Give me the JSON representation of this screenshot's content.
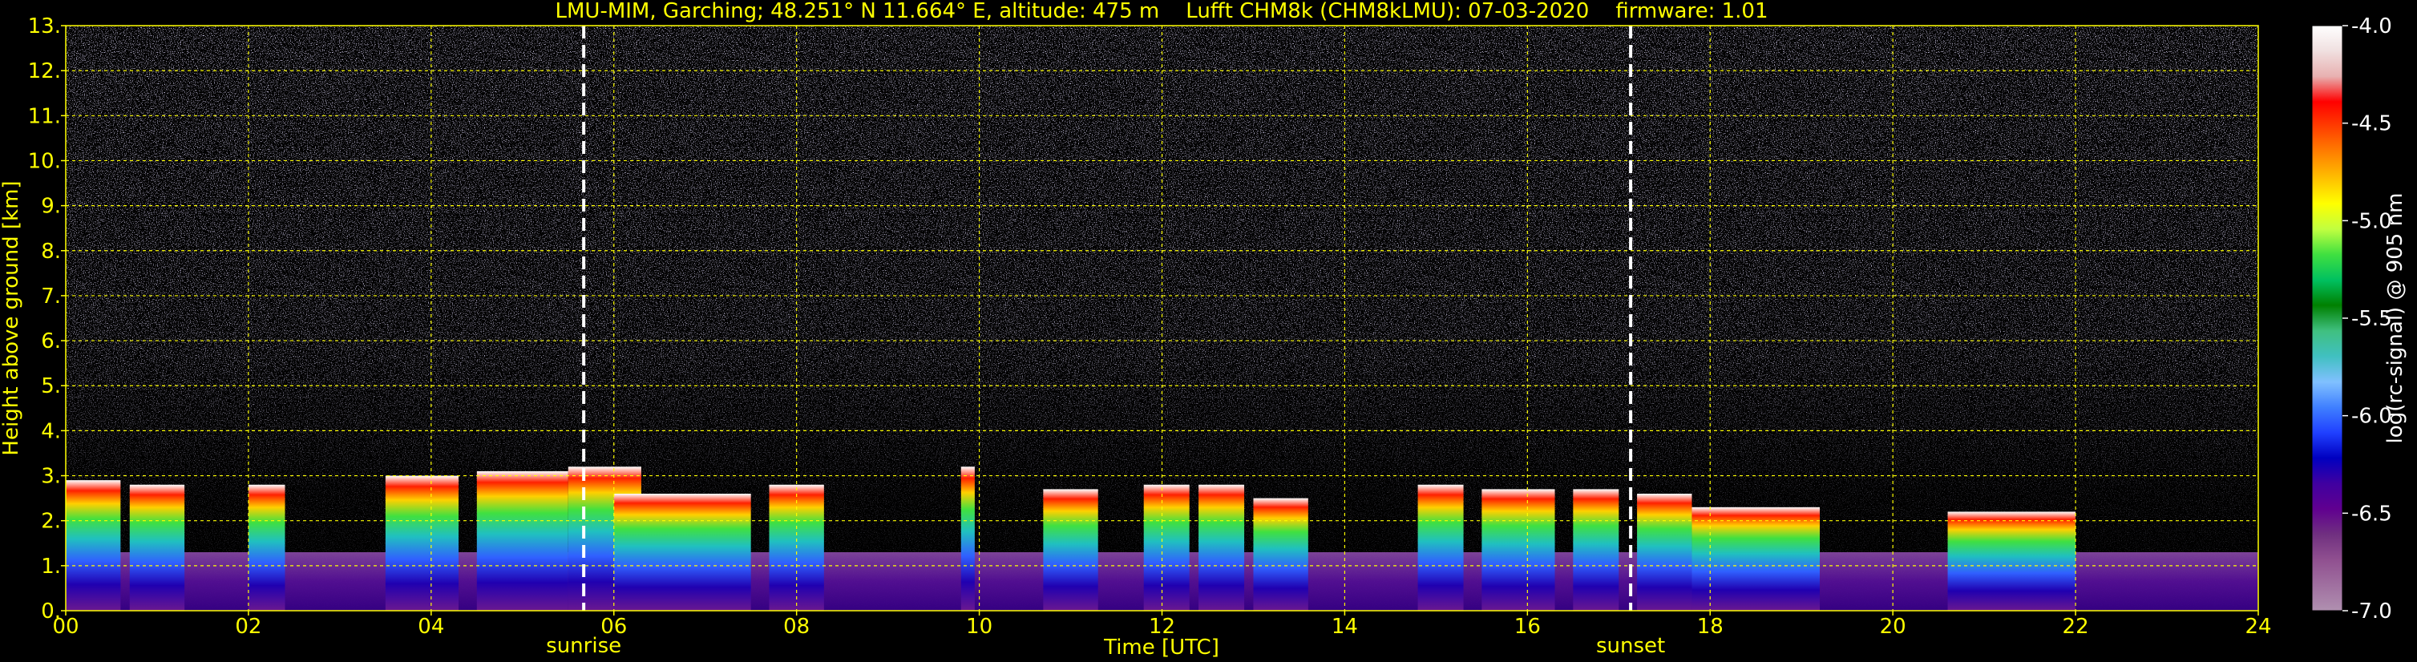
{
  "chart_data": {
    "type": "heatmap",
    "title": "LMU-MIM, Garching; 48.251° N 11.664° E, altitude: 475 m    Lufft CHM8k (CHM8kLMU): 07-03-2020    firmware: 1.01",
    "xlabel": "Time [UTC]",
    "ylabel": "Height above ground [km]",
    "xlim": [
      0,
      24
    ],
    "ylim": [
      0,
      13
    ],
    "x_ticks": [
      "00",
      "02",
      "04",
      "06",
      "08",
      "10",
      "12",
      "14",
      "16",
      "18",
      "20",
      "22",
      "24"
    ],
    "y_ticks": [
      "0.",
      "1.",
      "2.",
      "3.",
      "4.",
      "5.",
      "6.",
      "7.",
      "8.",
      "9.",
      "10.",
      "11.",
      "12.",
      "13."
    ],
    "grid": true,
    "colorbar": {
      "label": "log(rc-signal) @ 905 nm",
      "range": [
        -7.0,
        -4.0
      ],
      "ticks": [
        "-4.0",
        "-4.5",
        "-5.0",
        "-5.5",
        "-6.0",
        "-6.5",
        "-7.0"
      ],
      "colors": [
        "#ffffff",
        "#f0e0e0",
        "#e8b0b0",
        "#ff0000",
        "#ff4000",
        "#ff8000",
        "#ffc000",
        "#ffff00",
        "#c0ff40",
        "#40e040",
        "#00c060",
        "#008000",
        "#40c080",
        "#40c0c0",
        "#80c0ff",
        "#4080ff",
        "#2040ff",
        "#0000c0",
        "#4000a0",
        "#600090",
        "#703080",
        "#905090",
        "#a070a0",
        "#b090b0"
      ]
    },
    "annotations": [
      {
        "label": "sunrise",
        "x": 5.67
      },
      {
        "label": "sunset",
        "x": 17.13
      }
    ],
    "cloud_regions": [
      {
        "x_start": 0.0,
        "x_end": 0.6,
        "top_km": 2.9
      },
      {
        "x_start": 0.7,
        "x_end": 1.3,
        "top_km": 2.8
      },
      {
        "x_start": 2.0,
        "x_end": 2.4,
        "top_km": 2.8
      },
      {
        "x_start": 3.5,
        "x_end": 4.3,
        "top_km": 3.0
      },
      {
        "x_start": 4.5,
        "x_end": 5.5,
        "top_km": 3.1
      },
      {
        "x_start": 5.5,
        "x_end": 6.3,
        "top_km": 3.2
      },
      {
        "x_start": 6.0,
        "x_end": 7.5,
        "top_km": 2.6
      },
      {
        "x_start": 7.7,
        "x_end": 8.3,
        "top_km": 2.8
      },
      {
        "x_start": 9.8,
        "x_end": 9.95,
        "top_km": 3.2
      },
      {
        "x_start": 10.7,
        "x_end": 11.3,
        "top_km": 2.7
      },
      {
        "x_start": 11.8,
        "x_end": 12.3,
        "top_km": 2.8
      },
      {
        "x_start": 12.4,
        "x_end": 12.9,
        "top_km": 2.8
      },
      {
        "x_start": 13.0,
        "x_end": 13.6,
        "top_km": 2.5
      },
      {
        "x_start": 14.8,
        "x_end": 15.3,
        "top_km": 2.8
      },
      {
        "x_start": 15.5,
        "x_end": 16.3,
        "top_km": 2.7
      },
      {
        "x_start": 16.5,
        "x_end": 17.0,
        "top_km": 2.7
      },
      {
        "x_start": 17.2,
        "x_end": 17.8,
        "top_km": 2.6
      },
      {
        "x_start": 17.8,
        "x_end": 19.2,
        "top_km": 2.3
      },
      {
        "x_start": 20.6,
        "x_end": 22.0,
        "top_km": 2.2
      }
    ]
  }
}
